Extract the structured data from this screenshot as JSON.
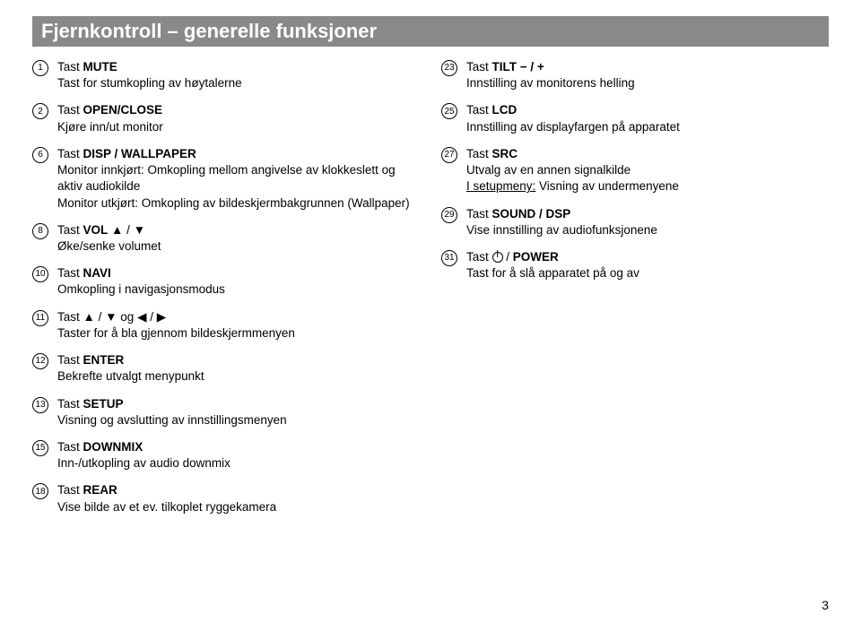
{
  "header": "Fjernkontroll – generelle funksjoner",
  "page_number": "3",
  "left": [
    {
      "n": "1",
      "title": "Tast <b>MUTE</b>",
      "desc": "Tast for stumkopling av høytalerne"
    },
    {
      "n": "2",
      "title": "Tast <b>OPEN/CLOSE</b>",
      "desc": "Kjøre inn/ut monitor"
    },
    {
      "n": "6",
      "title": "Tast <b>DISP / WALLPAPER</b>",
      "desc": "Monitor innkjørt: Omkopling mellom angivelse av klokkeslett og aktiv audiokilde<br>Monitor utkjørt: Omkopling av bildeskjermbakgrunnen (Wallpaper)"
    },
    {
      "n": "8",
      "title": "Tast <b>VOL</b> <span class='arrow'>▲</span> / <span class='arrow'>▼</span>",
      "desc": "Øke/senke volumet"
    },
    {
      "n": "10",
      "title": "Tast <b>NAVI</b>",
      "desc": "Omkopling i navigasjonsmodus"
    },
    {
      "n": "11",
      "title": "Tast <span class='arrow'>▲</span> / <span class='arrow'>▼</span> og <span class='arrow'>◀</span> / <span class='arrow'>▶</span>",
      "desc": "Taster for å bla gjennom bildeskjermmenyen"
    },
    {
      "n": "12",
      "title": "Tast <b>ENTER</b>",
      "desc": "Bekrefte utvalgt menypunkt"
    },
    {
      "n": "13",
      "title": "Tast <b>SETUP</b>",
      "desc": "Visning og avslutting av innstillingsmenyen"
    },
    {
      "n": "15",
      "title": "Tast <b>DOWNMIX</b>",
      "desc": "Inn-/utkopling av audio downmix"
    },
    {
      "n": "18",
      "title": "Tast <b>REAR</b>",
      "desc": "Vise bilde av et ev. tilkoplet ryggekamera"
    }
  ],
  "right": [
    {
      "n": "23",
      "title": "Tast <b>TILT − / +</b>",
      "desc": "Innstilling av monitorens helling"
    },
    {
      "n": "25",
      "title": "Tast <b>LCD</b>",
      "desc": "Innstilling av displayfargen på apparatet"
    },
    {
      "n": "27",
      "title": "Tast <b>SRC</b>",
      "desc": "Utvalg av en annen signalkilde<br><u>I setupmeny:</u> Visning av undermenyene"
    },
    {
      "n": "29",
      "title": "Tast <b>SOUND / DSP</b>",
      "desc": "Vise innstilling av audiofunksjonene"
    },
    {
      "n": "31",
      "title": "Tast <span class='power-icon' data-name='power-icon' data-interactable='false'></span> / <b>POWER</b>",
      "desc": "Tast for å slå apparatet på og av"
    }
  ]
}
